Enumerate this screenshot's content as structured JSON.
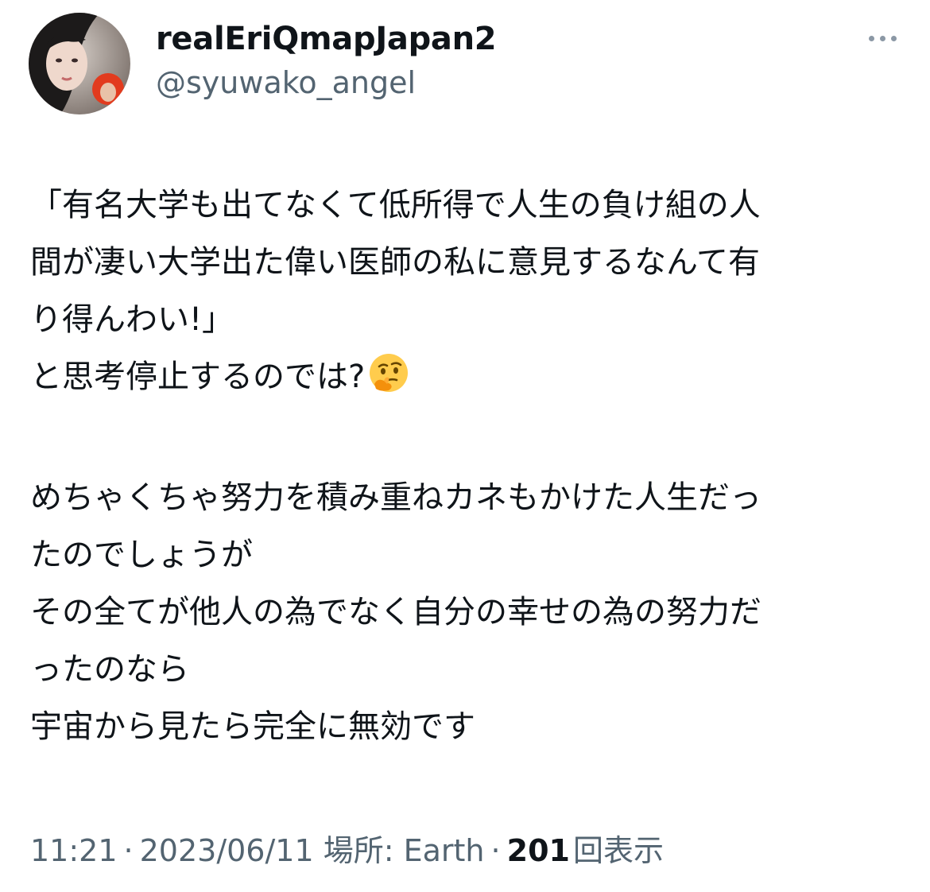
{
  "tweet": {
    "author": {
      "display_name": "realEriQmapJapan2",
      "handle": "@syuwako_angel"
    },
    "more_icon": "more-horizontal-icon",
    "text_lines": [
      "「有名大学も出てなくて低所得で人生の負け組の人",
      "間が凄い大学出た偉い医師の私に意見するなんて有",
      "り得んわい!」",
      "と思考停止するのでは?",
      "",
      "めちゃくちゃ努力を積み重ねカネもかけた人生だっ",
      "たのでしょうが",
      "その全てが他人の為でなく自分の幸せの為の努力だ",
      "ったのなら",
      "宇宙から見たら完全に無効です"
    ],
    "emoji_icon": "thinking-face-icon",
    "meta": {
      "time": "11:21",
      "separator": "·",
      "date": "2023/06/11",
      "location": "場所: Earth",
      "views_count": "201",
      "views_label": "回表示"
    }
  },
  "colors": {
    "text_primary": "#0f1419",
    "text_secondary": "#536471",
    "more_dots": "#8b98a5",
    "emoji_yellow": "#ffcc4d"
  }
}
